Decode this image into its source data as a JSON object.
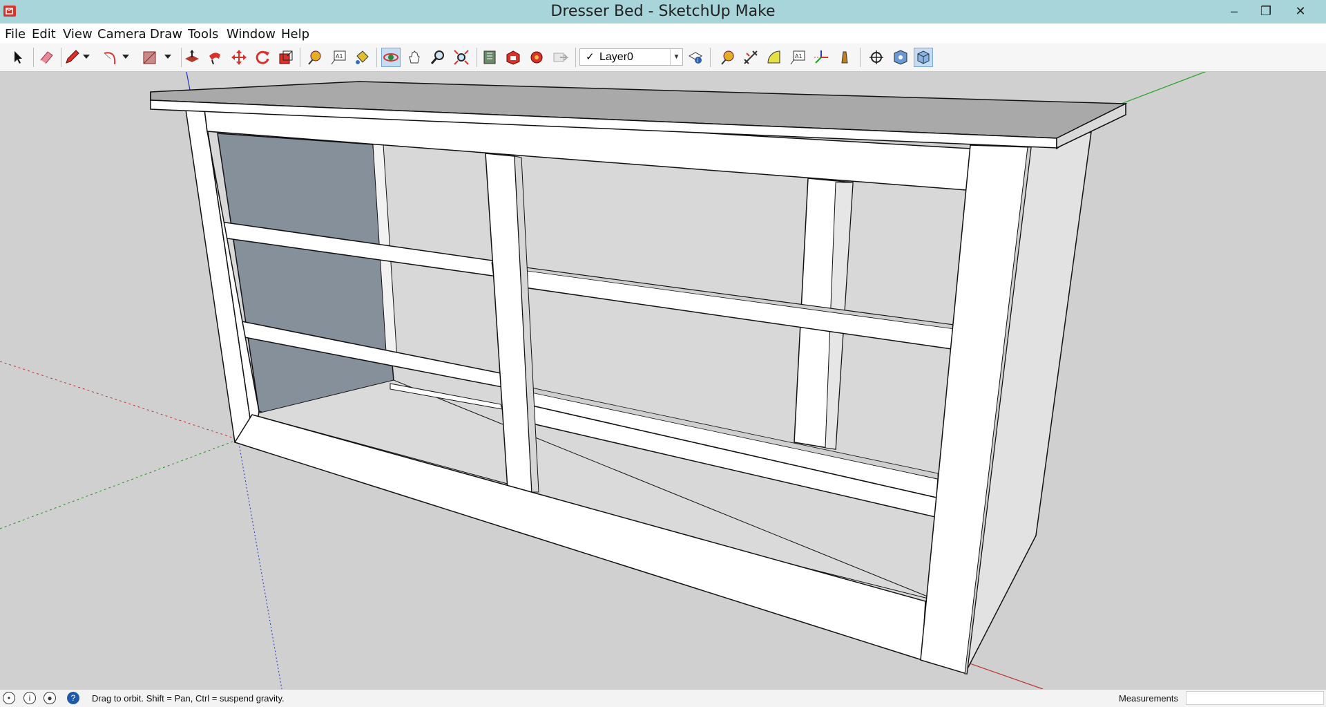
{
  "window": {
    "title": "Dresser Bed - SketchUp Make",
    "minimize_label": "–",
    "restore_label": "❐",
    "close_label": "✕"
  },
  "menu": [
    "File",
    "Edit",
    "View",
    "Camera",
    "Draw",
    "Tools",
    "Window",
    "Help"
  ],
  "toolbar": {
    "layer": "Layer0",
    "layer_check": "✓",
    "dropdown_arrow": "▼",
    "tools": [
      "select-tool-icon",
      "eraser-tool-icon",
      "pencil-line-tool-icon",
      "arc-tool-icon",
      "rectangle-tool-icon",
      "push-pull-tool-icon",
      "follow-me-tool-icon",
      "move-tool-icon",
      "rotate-tool-icon",
      "scale-tool-icon",
      "tape-measure-tool-icon",
      "text-tool-icon",
      "paint-bucket-tool-icon",
      "orbit-tool-icon",
      "pan-tool-icon",
      "zoom-tool-icon",
      "zoom-extents-tool-icon",
      "warehouse-icon",
      "share-model-icon",
      "extension-warehouse-icon",
      "send-to-layout-icon",
      "layer-manager-icon",
      "tape-measure-icon",
      "dimension-icon",
      "protractor-icon",
      "text-label-icon",
      "axes-tool-icon",
      "section-plane-icon",
      "position-camera-icon",
      "look-around-icon",
      "walk-icon"
    ]
  },
  "status": {
    "hint": "Drag to orbit. Shift = Pan, Ctrl = suspend gravity.",
    "measurements_label": "Measurements",
    "measurements_value": "",
    "icons": [
      "geolocation-icon",
      "credits-icon",
      "user-icon",
      "instructor-help-icon"
    ],
    "icon_glyphs": [
      "•",
      "i",
      "●",
      "?"
    ]
  },
  "colors": {
    "titlebar": "#a7d5d9",
    "background": "#d0d0d0",
    "active_tool": "#c5dcf2",
    "red_axis": "#d02020",
    "green_axis": "#20a020",
    "blue_axis": "#2020c0"
  }
}
